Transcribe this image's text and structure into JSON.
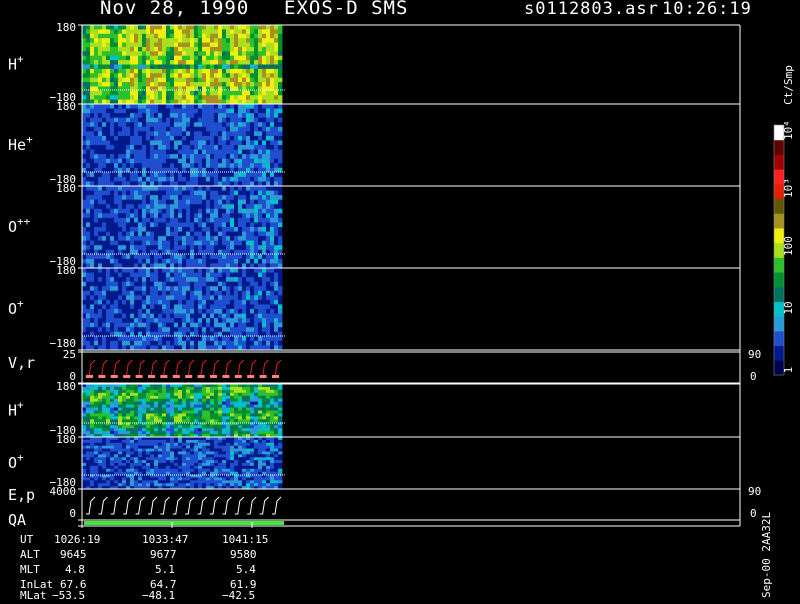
{
  "header": {
    "date": "Nov 28, 1990",
    "instrument": "EXOS-D SMS",
    "file": "s0112803.asr",
    "time": "10:26:19"
  },
  "colors": {
    "background": "#000000",
    "frame": "#ffffff",
    "vr_trace": "#e0201c",
    "ep_trace": "#ffffff",
    "qa_bar": "#3ce83c"
  },
  "chart_data": {
    "type": "heatmap",
    "title": "EXOS-D SMS",
    "color_scale": {
      "label": "Ct/Smp",
      "tick_labels": [
        "1",
        "10",
        "100",
        "10³",
        "10⁴"
      ],
      "scale": "log",
      "colors": [
        "#00004e",
        "#001a8c",
        "#1f4fd0",
        "#2a9ad8",
        "#00c0c8",
        "#007060",
        "#009030",
        "#2cc02c",
        "#a8e020",
        "#f0f010",
        "#a89020",
        "#605808",
        "#e02000",
        "#ff2020",
        "#a00000",
        "#600000",
        "#ffffff"
      ]
    },
    "panels": [
      {
        "label": "H",
        "charge": "+",
        "y_top": "180",
        "y_bottom": "−180",
        "intensity": "high"
      },
      {
        "label": "He",
        "charge": "+",
        "y_top": "180",
        "y_bottom": "−180",
        "intensity": "low"
      },
      {
        "label": "O",
        "charge": "++",
        "y_top": "180",
        "y_bottom": "−180",
        "intensity": "low"
      },
      {
        "label": "O",
        "charge": "+",
        "y_top": "180",
        "y_bottom": "−180",
        "intensity": "low"
      },
      {
        "label": "V,r",
        "y_left_top": "25",
        "y_left_bottom": "0",
        "y_right_top": "90",
        "y_right_bottom": "0"
      },
      {
        "label": "H",
        "charge": "+",
        "y_top": "180",
        "y_bottom": "−180",
        "intensity": "medium"
      },
      {
        "label": "O",
        "charge": "+",
        "y_top": "180",
        "y_bottom": "−180",
        "intensity": "low"
      },
      {
        "label": "E,p",
        "y_left_top": "4000",
        "y_left_bottom": "0",
        "y_right_top": "90",
        "y_right_bottom": "0"
      },
      {
        "label": "QA"
      }
    ],
    "ut_ticks": [
      "1026:19",
      "1033:47",
      "1041:15"
    ],
    "orbit_table": {
      "rows": [
        {
          "name": "UT",
          "values": [
            "1026:19",
            "1033:47",
            "1041:15"
          ]
        },
        {
          "name": "ALT",
          "values": [
            "9645",
            "9677",
            "9580"
          ]
        },
        {
          "name": "MLT",
          "values": [
            "4.8",
            "5.1",
            "5.4"
          ]
        },
        {
          "name": "InLat",
          "values": [
            "67.6",
            "64.7",
            "61.9"
          ]
        },
        {
          "name": "MLat",
          "values": [
            "−53.5",
            "−48.1",
            "−42.5"
          ]
        }
      ]
    }
  },
  "side_label": "Sep-00  2AA32L"
}
